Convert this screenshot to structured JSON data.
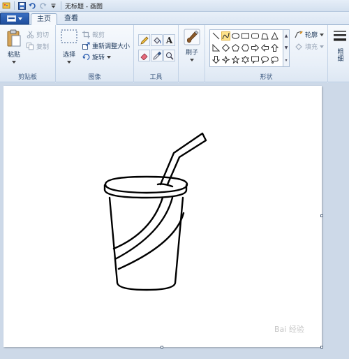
{
  "window": {
    "title": "无标题 - 画图"
  },
  "tabs": [
    {
      "label": "主页",
      "active": true
    },
    {
      "label": "查看",
      "active": false
    }
  ],
  "clipboard": {
    "paste_label": "粘贴",
    "cut_label": "剪切",
    "copy_label": "复制",
    "group_label": "剪贴板"
  },
  "image": {
    "select_label": "选择",
    "crop_label": "裁剪",
    "resize_label": "重新调整大小",
    "rotate_label": "旋转",
    "group_label": "图像"
  },
  "tools": {
    "group_label": "工具",
    "text_glyph": "A"
  },
  "brushes": {
    "label": "刷子"
  },
  "shapes": {
    "group_label": "形状",
    "outline_label": "轮廓",
    "fill_label": "填充"
  },
  "size": {
    "label": "粗细"
  },
  "watermark": {
    "text": "Bai 经验"
  },
  "colors": {
    "accent": "#1f4f9e",
    "selected_shape": "#fde28a",
    "canvas": "#ffffff",
    "workspace": "#cdd9e8"
  }
}
